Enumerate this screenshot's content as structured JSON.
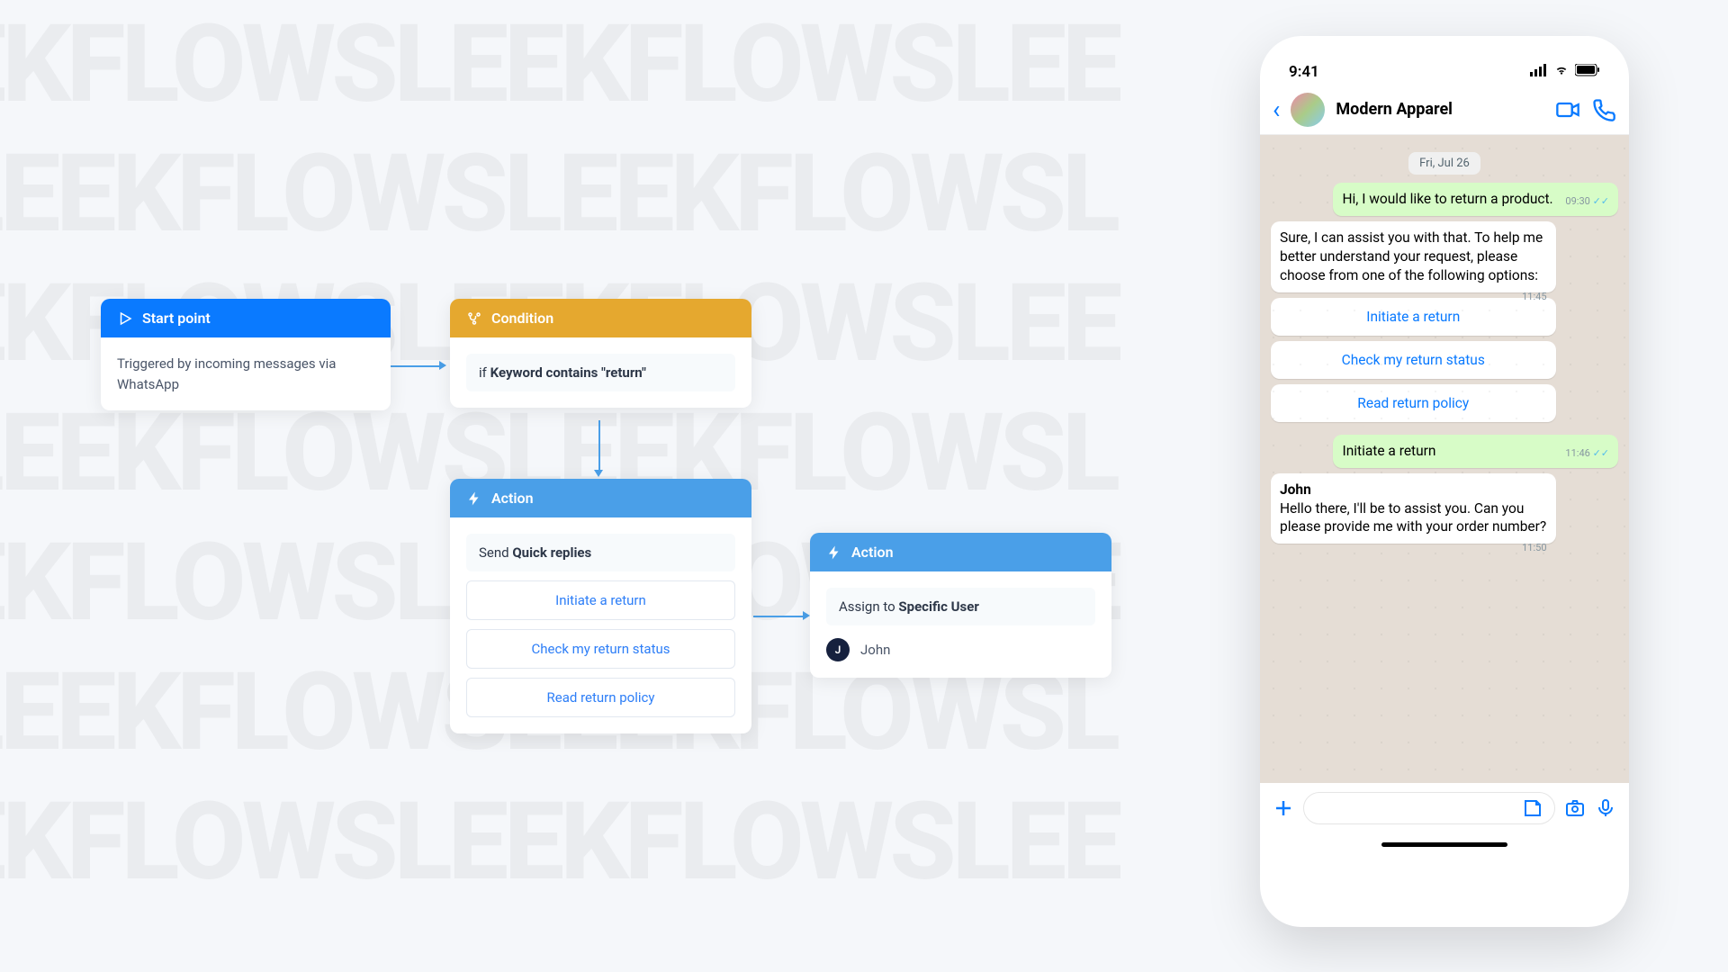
{
  "flow": {
    "start": {
      "title": "Start point",
      "body": "Triggered by incoming messages via WhatsApp"
    },
    "condition": {
      "title": "Condition",
      "prefix": "if ",
      "bold": "Keyword contains \"return\""
    },
    "action1": {
      "title": "Action",
      "send_prefix": "Send ",
      "send_bold": "Quick replies",
      "options": [
        "Initiate a return",
        "Check my return status",
        "Read return policy"
      ]
    },
    "action2": {
      "title": "Action",
      "assign_prefix": "Assign to ",
      "assign_bold": "Specific User",
      "user_initial": "J",
      "user_name": "John"
    }
  },
  "phone": {
    "time": "9:41",
    "contact_name": "Modern Apparel",
    "date_label": "Fri, Jul 26",
    "msg_out1": "Hi, I would like to return a product.",
    "msg_out1_time": "09:30",
    "msg_in1": "Sure, I can assist you with that. To help me better understand your request, please choose from one of the following options:",
    "msg_in1_time": "11:45",
    "btn1": "Initiate a return",
    "btn2": "Check my return status",
    "btn3": "Read return policy",
    "msg_out2": "Initiate a return",
    "msg_out2_time": "11:46",
    "msg_in2_name": "John",
    "msg_in2": "Hello there, I'll be to assist you. Can you please provide me with your order number?",
    "msg_in2_time": "11:50"
  }
}
